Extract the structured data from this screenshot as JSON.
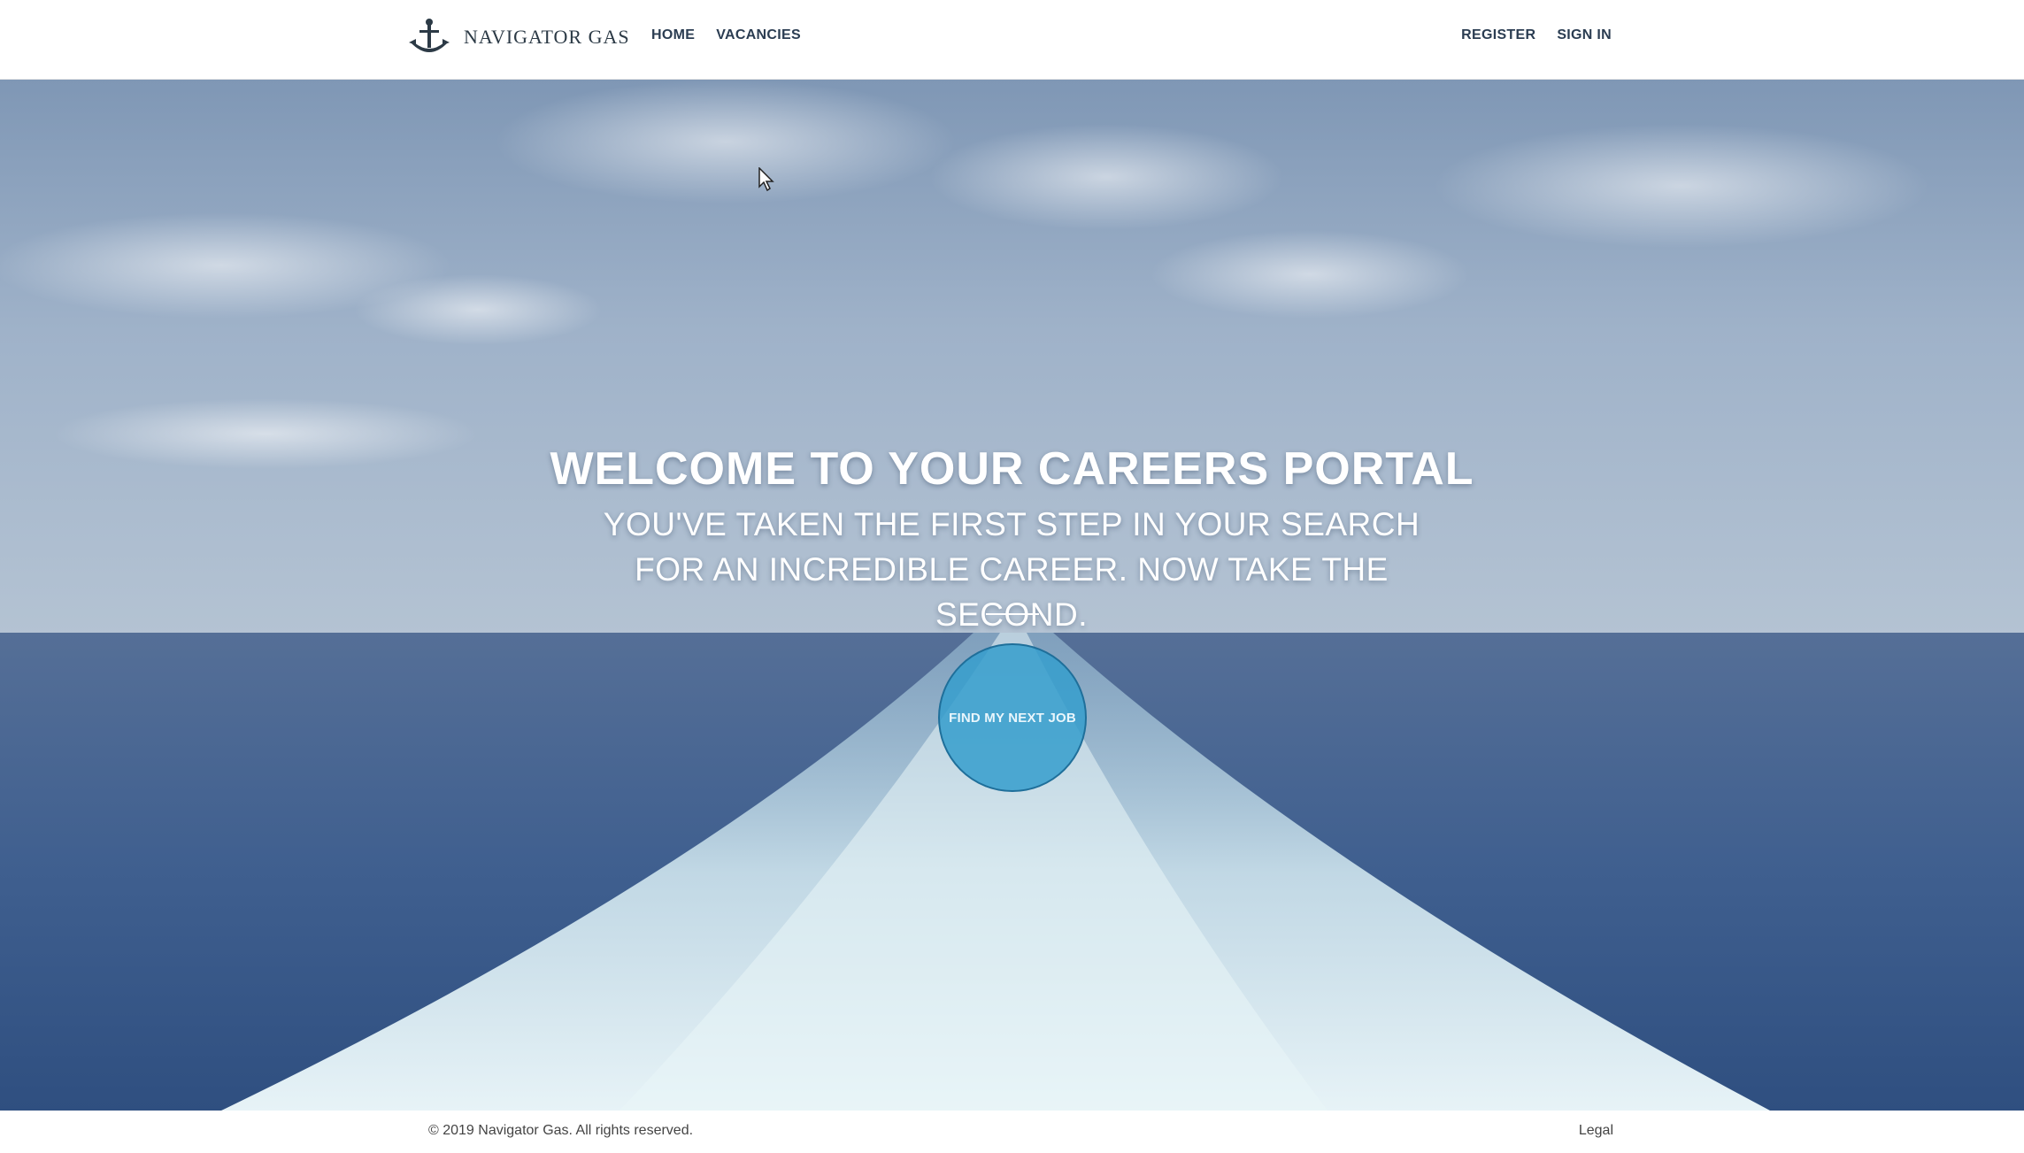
{
  "header": {
    "brand_name": "NAVIGATOR GAS",
    "logo_icon": "anchor-sextant-logo",
    "nav_left": [
      {
        "label": "HOME"
      },
      {
        "label": "VACANCIES"
      }
    ],
    "nav_right": [
      {
        "label": "REGISTER"
      },
      {
        "label": "SIGN IN"
      }
    ]
  },
  "hero": {
    "title": "WELCOME TO YOUR CAREERS PORTAL",
    "subtitle": "YOU'VE TAKEN THE FIRST STEP IN YOUR SEARCH FOR AN INCREDIBLE CAREER. NOW TAKE THE SECOND.",
    "cta_label": "FIND MY NEXT JOB",
    "background": "ocean-ship-wake-photo"
  },
  "footer": {
    "copyright": "© 2019 Navigator Gas. All rights reserved.",
    "legal_label": "Legal"
  },
  "colors": {
    "nav_text": "#2b3d52",
    "cta_fill": "#359ecc",
    "cta_border": "#1f6f9a",
    "sky": "#8aa2bf",
    "sea": "#3c5d8d"
  }
}
